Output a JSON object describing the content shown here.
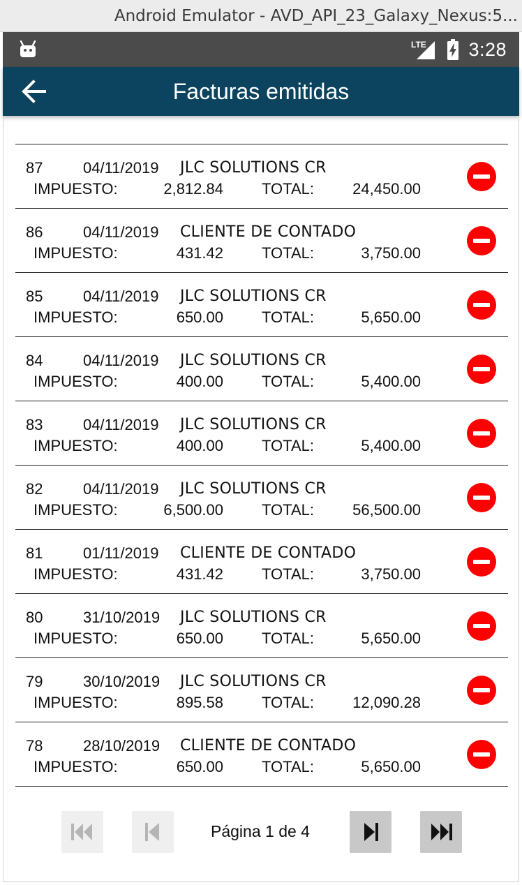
{
  "window": {
    "title": "Android Emulator - AVD_API_23_Galaxy_Nexus:5..."
  },
  "status_bar": {
    "time": "3:28",
    "network_label": "LTE",
    "icons": [
      "android-icon",
      "lte-signal-icon",
      "battery-charging-icon"
    ]
  },
  "app_bar": {
    "title": "Facturas emitidas",
    "back_icon": "arrow-left-icon"
  },
  "labels": {
    "tax": "IMPUESTO:",
    "total": "TOTAL:"
  },
  "invoices": [
    {
      "number": "87",
      "date": "04/11/2019",
      "client": "JLC SOLUTIONS CR",
      "tax": "2,812.84",
      "total": "24,450.00"
    },
    {
      "number": "86",
      "date": "04/11/2019",
      "client": "CLIENTE DE CONTADO",
      "tax": "431.42",
      "total": "3,750.00"
    },
    {
      "number": "85",
      "date": "04/11/2019",
      "client": "JLC SOLUTIONS CR",
      "tax": "650.00",
      "total": "5,650.00"
    },
    {
      "number": "84",
      "date": "04/11/2019",
      "client": "JLC SOLUTIONS CR",
      "tax": "400.00",
      "total": "5,400.00"
    },
    {
      "number": "83",
      "date": "04/11/2019",
      "client": "JLC SOLUTIONS CR",
      "tax": "400.00",
      "total": "5,400.00"
    },
    {
      "number": "82",
      "date": "04/11/2019",
      "client": "JLC SOLUTIONS CR",
      "tax": "6,500.00",
      "total": "56,500.00"
    },
    {
      "number": "81",
      "date": "01/11/2019",
      "client": "CLIENTE DE CONTADO",
      "tax": "431.42",
      "total": "3,750.00"
    },
    {
      "number": "80",
      "date": "31/10/2019",
      "client": "JLC SOLUTIONS CR",
      "tax": "650.00",
      "total": "5,650.00"
    },
    {
      "number": "79",
      "date": "30/10/2019",
      "client": "JLC SOLUTIONS CR",
      "tax": "895.58",
      "total": "12,090.28"
    },
    {
      "number": "78",
      "date": "28/10/2019",
      "client": "CLIENTE DE CONTADO",
      "tax": "650.00",
      "total": "5,650.00"
    }
  ],
  "pagination": {
    "label": "Página 1 de 4",
    "first_enabled": false,
    "prev_enabled": false,
    "next_enabled": true,
    "last_enabled": true
  },
  "colors": {
    "app_bar": "#0c4460",
    "status_bar": "#4b4b4b",
    "delete": "#ff0000",
    "pager_enabled": "#c8c8c8",
    "pager_disabled": "#efefef"
  }
}
